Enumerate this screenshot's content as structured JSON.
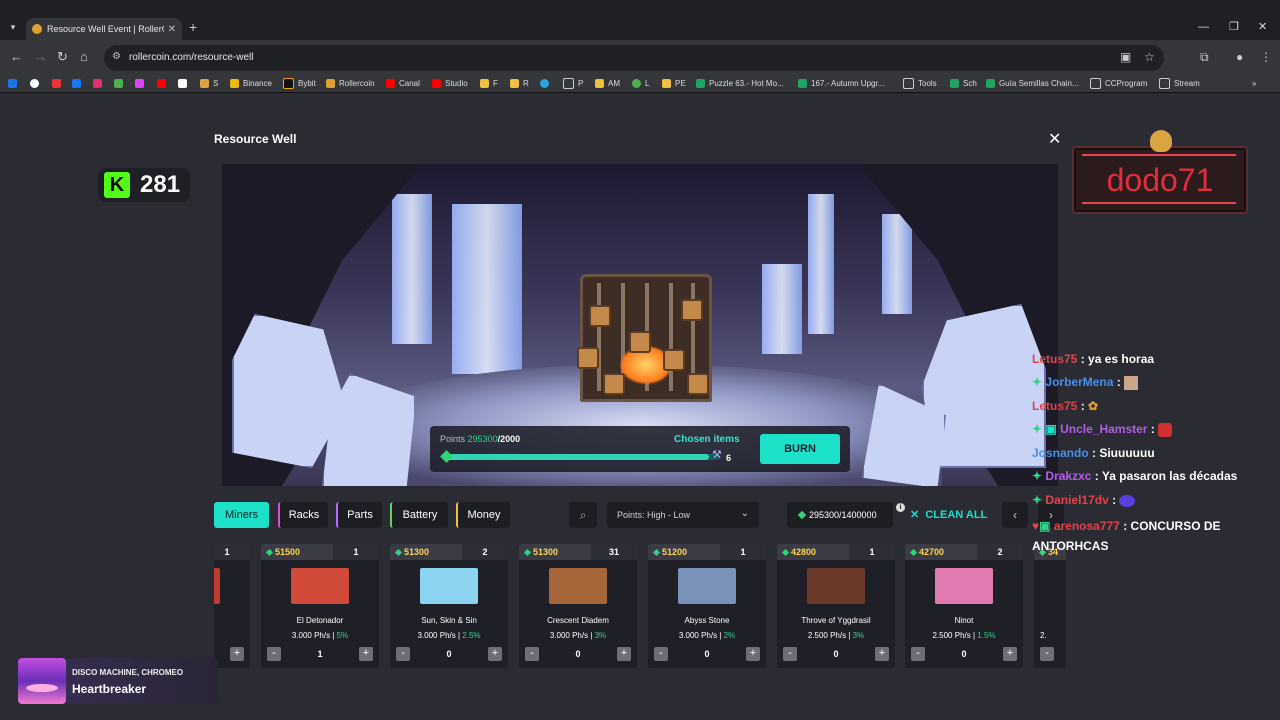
{
  "browser": {
    "tab_title": "Resource Well Event | RollerCoin",
    "url": "rollercoin.com/resource-well",
    "bookmarks": [
      "S",
      "Binance",
      "Bybit",
      "Rollercoin",
      "Canal",
      "Studio",
      "F",
      "R",
      "P",
      "AM",
      "L",
      "PE",
      "Puzzle 63.- Hot Mo...",
      "167.- Autumn Upgr...",
      "Tools",
      "Sch",
      "Guía Semillas Chain...",
      "CCProgram",
      "Stream"
    ]
  },
  "page": {
    "title": "Resource Well",
    "close_label": "✕"
  },
  "kick": {
    "viewers": "281"
  },
  "streamer": {
    "name": "dodo71"
  },
  "hud": {
    "points_label": "Points",
    "points_current": "295300",
    "points_goal": "/2000",
    "progress_fraction": 0.96,
    "chosen_items_label": "Chosen items",
    "chosen_count": "6",
    "burn_label": "BURN"
  },
  "filters": {
    "tabs": [
      {
        "label": "Miners",
        "color": "#1de0c8",
        "active": true
      },
      {
        "label": "Racks",
        "color": "#d94fe0",
        "active": false
      },
      {
        "label": "Parts",
        "color": "#b86bff",
        "active": false
      },
      {
        "label": "Battery",
        "color": "#5fd35a",
        "active": false
      },
      {
        "label": "Money",
        "color": "#f0c040",
        "active": false
      }
    ],
    "sort_label": "Points: High - Low",
    "points_summary": "295300/1400000",
    "info_icon": "i",
    "clean_all_label": "CLEAN ALL"
  },
  "cards": [
    {
      "price": "",
      "qty": "1",
      "name": "",
      "power": "",
      "bonus": "3%",
      "count": "",
      "img": "#c23a32"
    },
    {
      "price": "51500",
      "qty": "1",
      "name": "El Detonador",
      "power": "3.000 Ph/s | ",
      "bonus": "5%",
      "count": "1",
      "img": "#d24a3a"
    },
    {
      "price": "51300",
      "qty": "2",
      "name": "Sun, Skin & Sin",
      "power": "3.000 Ph/s | ",
      "bonus": "2.5%",
      "count": "0",
      "img": "#8cd3f0"
    },
    {
      "price": "51300",
      "qty": "31",
      "name": "Crescent Diadem",
      "power": "3.000 Ph/s | ",
      "bonus": "3%",
      "count": "0",
      "img": "#a7663a"
    },
    {
      "price": "51200",
      "qty": "1",
      "name": "Abyss Stone",
      "power": "3.000 Ph/s | ",
      "bonus": "2%",
      "count": "0",
      "img": "#7a92b8"
    },
    {
      "price": "42800",
      "qty": "1",
      "name": "Throve of Yggdrasil",
      "power": "2.500 Ph/s | ",
      "bonus": "3%",
      "count": "0",
      "img": "#6b3a2a"
    },
    {
      "price": "42700",
      "qty": "2",
      "name": "Ninot",
      "power": "2.500 Ph/s | ",
      "bonus": "1.5%",
      "count": "0",
      "img": "#e07ab0"
    },
    {
      "price": "34",
      "qty": "",
      "name": "",
      "power": "2.",
      "bonus": "",
      "count": "",
      "img": "#d94fe0"
    }
  ],
  "chat": [
    {
      "user": "Letus75",
      "text": "ya es horaa",
      "color": "#e2434b"
    },
    {
      "user": "JorberMena",
      "text": "",
      "color": "#4a8fe8"
    },
    {
      "user": "Letus75",
      "text": "",
      "color": "#e2434b"
    },
    {
      "user": "Uncle_Hamster",
      "text": "",
      "color": "#b35ce8"
    },
    {
      "user": "Josnando",
      "text": "Siuuuuuu",
      "color": "#4a8fe8"
    },
    {
      "user": "Drakzxc",
      "text": "Ya pasaron las décadas",
      "color": "#b35ce8"
    },
    {
      "user": "Daniel17dv",
      "text": "",
      "color": "#e2434b"
    },
    {
      "user": "arenosa777",
      "text": "CONCURSO DE ANTORHCAS",
      "color": "#e2434b"
    }
  ],
  "now_playing": {
    "artist": "DISCO MACHINE, CHROMEO",
    "track": "Heartbreaker"
  }
}
